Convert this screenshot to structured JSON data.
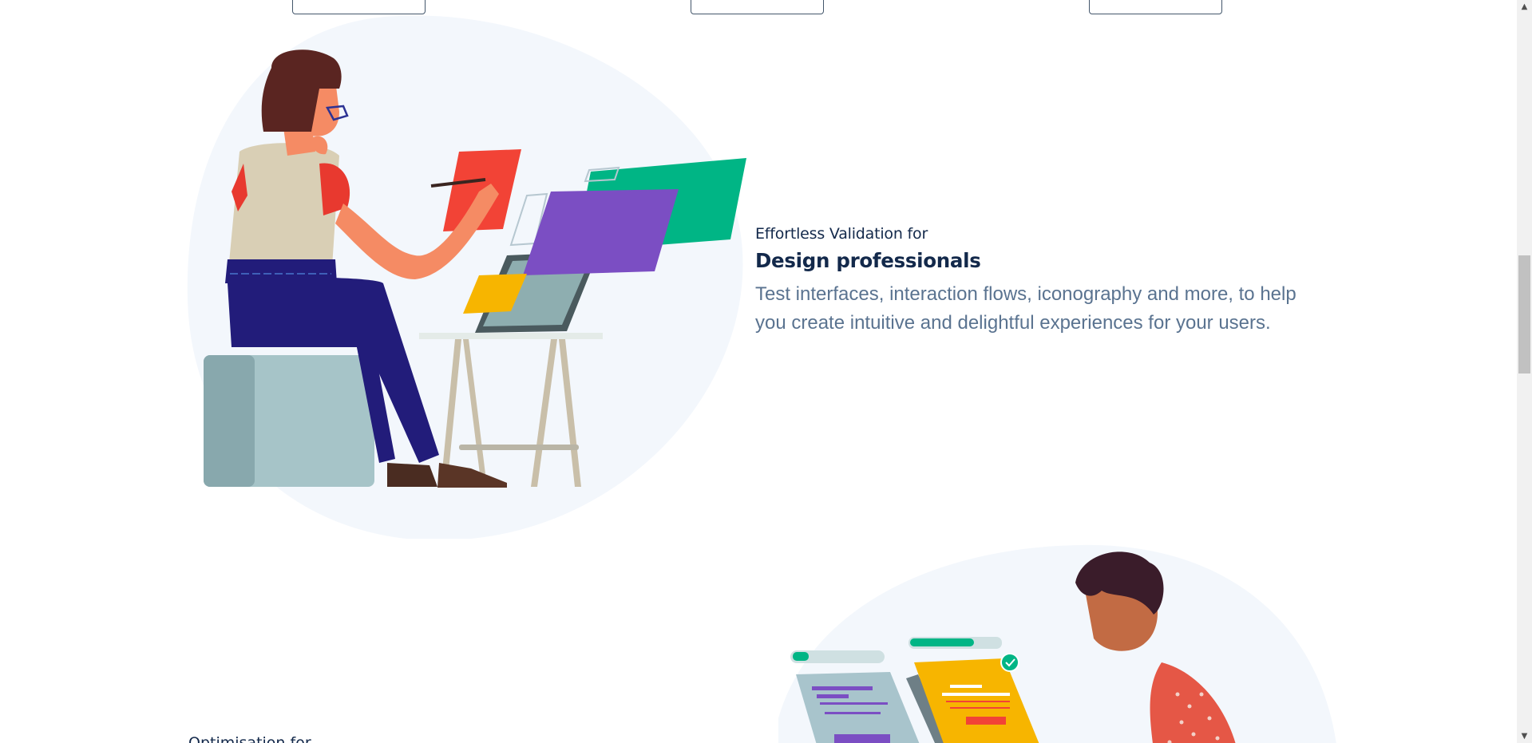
{
  "features": [
    {
      "eyebrow": "Effortless Validation for",
      "title": "Design professionals",
      "description": "Test interfaces, interaction flows, iconography and more, to help you create intuitive and delightful experiences for your users."
    },
    {
      "eyebrow": "Optimisation for"
    }
  ],
  "colors": {
    "heading": "#13294b",
    "body_text": "#5a7390",
    "blob": "#f3f7fc"
  },
  "scrollbar": {
    "up_icon": "triangle-up",
    "down_icon": "triangle-down"
  }
}
